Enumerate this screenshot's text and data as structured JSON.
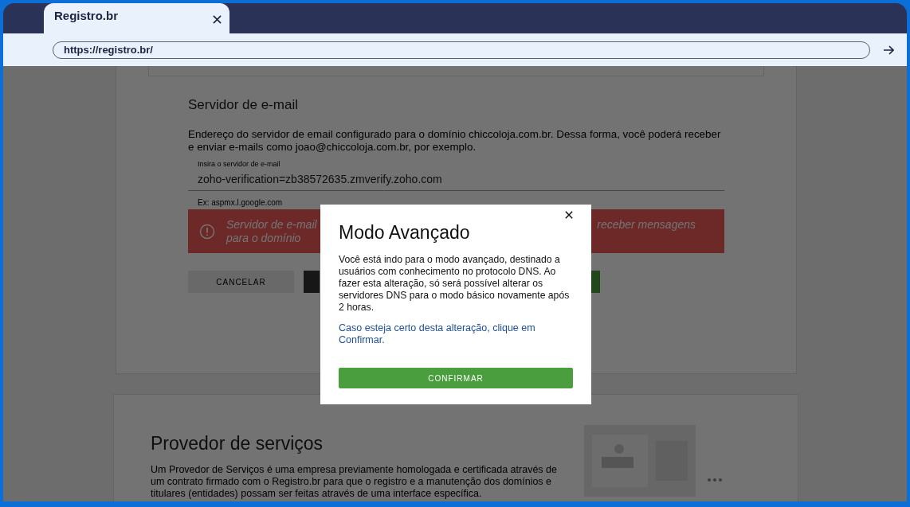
{
  "browser": {
    "tab_title": "Registro.br",
    "url": "https://registro.br/"
  },
  "email_section": {
    "title": "Servidor de e-mail",
    "description": "Endereço do servidor de email configurado para o domínio chiccoloja.com.br. Dessa forma, você poderá receber e enviar e-mails como joao@chiccoloja.com.br, por exemplo.",
    "field": {
      "label": "Insira o servidor de e-mail",
      "value": "zoho-verification=zb38572635.zmverify.zoho.com",
      "hint": "Ex: aspmx.l.google.com"
    },
    "alert": {
      "lines_left": [
        "Servidor de e-mail",
        "para o domínio"
      ],
      "text_right": "receber mensagens"
    },
    "buttons": [
      {
        "kind": "secondary",
        "label": "CANCELAR"
      },
      {
        "kind": "dark"
      },
      {
        "kind": "primary"
      }
    ]
  },
  "provider_section": {
    "title": "Provedor de serviços",
    "description": "Um Provedor de Serviços é uma empresa previamente homologada e certificada através de um contrato firmado com o Registro.br para que o registro e a manutenção dos domínios e titulares (entidades) possam ser feitas através de uma interface específica."
  },
  "modal": {
    "title": "Modo Avançado",
    "body": "Você está indo para o modo avançado, destinado a usuários com conhecimento no protocolo DNS. Ao fazer esta alteração, só será possível alterar os servidores DNS para o modo básico novamente após 2 horas.",
    "link": "Caso esteja certo desta alteração, clique em Confirmar.",
    "button": "CONFIRMAR"
  }
}
